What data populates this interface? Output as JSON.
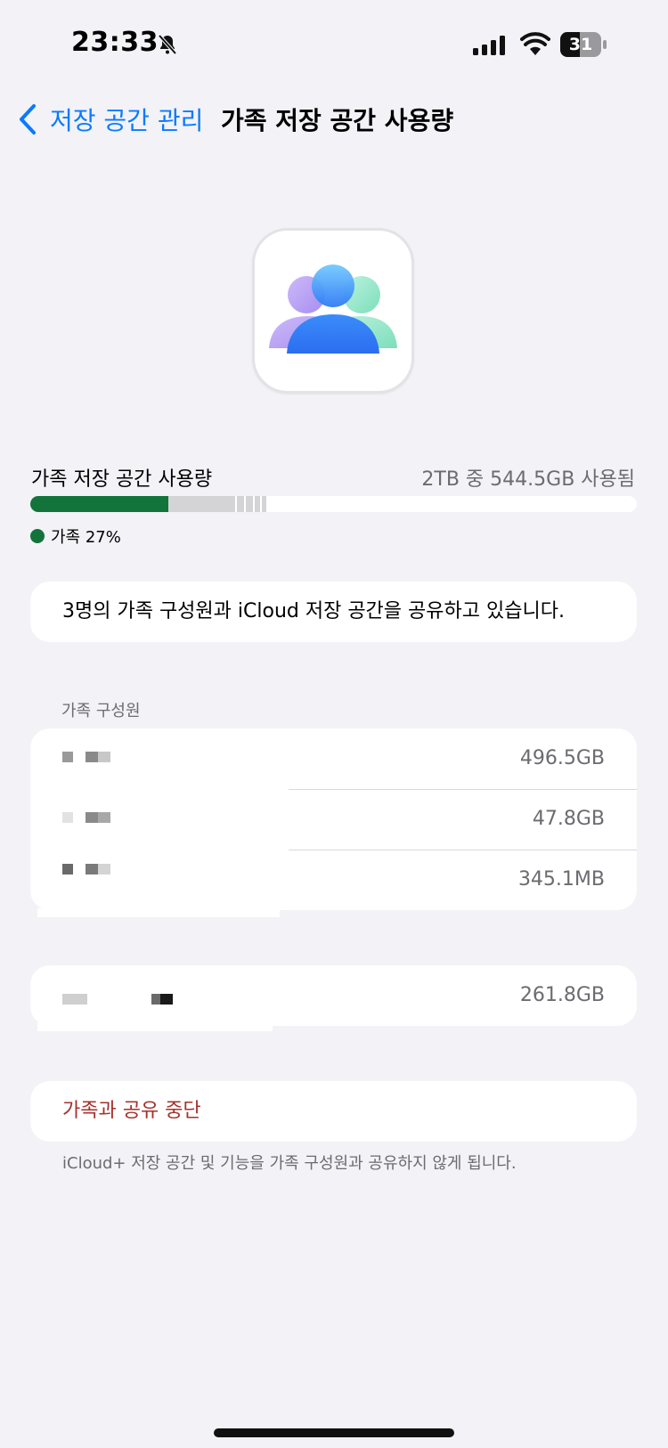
{
  "status_bar": {
    "time": "23:33",
    "battery": "31",
    "icons": [
      "bell-slash-icon",
      "cellular-signal-icon",
      "wifi-icon",
      "battery-icon"
    ]
  },
  "nav": {
    "back_label": "저장 공간 관리",
    "title": "가족 저장 공간 사용량"
  },
  "usage": {
    "label": "가족 저장 공간 사용량",
    "value": "2TB 중 544.5GB 사용됨",
    "legend": "가족 27%",
    "family_percent": 27
  },
  "info": {
    "text": "3명의 가족 구성원과 iCloud 저장 공간을 공유하고 있습니다."
  },
  "members": {
    "header": "가족 구성원",
    "rows": [
      {
        "size": "496.5GB"
      },
      {
        "size": "47.8GB"
      },
      {
        "size": "345.1MB"
      }
    ]
  },
  "other": {
    "size": "261.8GB"
  },
  "stop": {
    "label": "가족과 공유 중단",
    "note": "iCloud+ 저장 공간 및 기능을 가족 구성원과 공유하지 않게 됩니다."
  },
  "colors": {
    "accent": "#0a7aff",
    "family_green": "#12743a",
    "destructive": "#a4302c"
  }
}
